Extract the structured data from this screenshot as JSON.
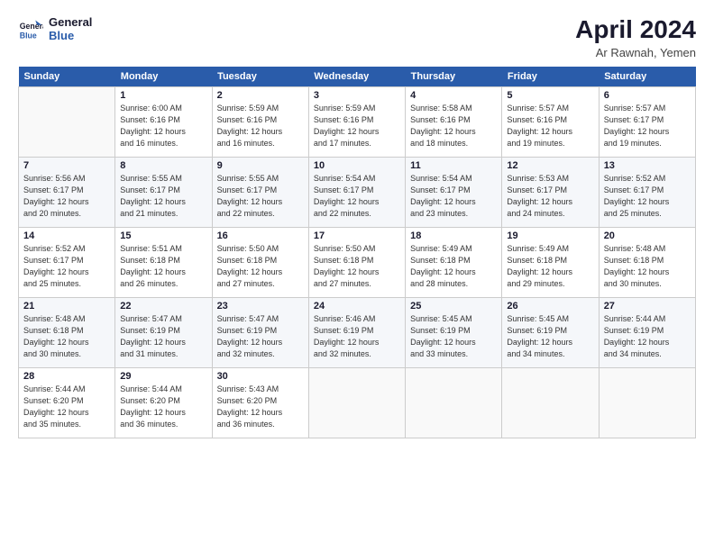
{
  "logo": {
    "line1": "General",
    "line2": "Blue"
  },
  "title": "April 2024",
  "location": "Ar Rawnah, Yemen",
  "days_of_week": [
    "Sunday",
    "Monday",
    "Tuesday",
    "Wednesday",
    "Thursday",
    "Friday",
    "Saturday"
  ],
  "weeks": [
    [
      {
        "day": null
      },
      {
        "day": "1",
        "sunrise": "6:00 AM",
        "sunset": "6:16 PM",
        "daylight": "12 hours and 16 minutes."
      },
      {
        "day": "2",
        "sunrise": "5:59 AM",
        "sunset": "6:16 PM",
        "daylight": "12 hours and 16 minutes."
      },
      {
        "day": "3",
        "sunrise": "5:59 AM",
        "sunset": "6:16 PM",
        "daylight": "12 hours and 17 minutes."
      },
      {
        "day": "4",
        "sunrise": "5:58 AM",
        "sunset": "6:16 PM",
        "daylight": "12 hours and 18 minutes."
      },
      {
        "day": "5",
        "sunrise": "5:57 AM",
        "sunset": "6:16 PM",
        "daylight": "12 hours and 19 minutes."
      },
      {
        "day": "6",
        "sunrise": "5:57 AM",
        "sunset": "6:17 PM",
        "daylight": "12 hours and 19 minutes."
      }
    ],
    [
      {
        "day": "7",
        "sunrise": "5:56 AM",
        "sunset": "6:17 PM",
        "daylight": "12 hours and 20 minutes."
      },
      {
        "day": "8",
        "sunrise": "5:55 AM",
        "sunset": "6:17 PM",
        "daylight": "12 hours and 21 minutes."
      },
      {
        "day": "9",
        "sunrise": "5:55 AM",
        "sunset": "6:17 PM",
        "daylight": "12 hours and 22 minutes."
      },
      {
        "day": "10",
        "sunrise": "5:54 AM",
        "sunset": "6:17 PM",
        "daylight": "12 hours and 22 minutes."
      },
      {
        "day": "11",
        "sunrise": "5:54 AM",
        "sunset": "6:17 PM",
        "daylight": "12 hours and 23 minutes."
      },
      {
        "day": "12",
        "sunrise": "5:53 AM",
        "sunset": "6:17 PM",
        "daylight": "12 hours and 24 minutes."
      },
      {
        "day": "13",
        "sunrise": "5:52 AM",
        "sunset": "6:17 PM",
        "daylight": "12 hours and 25 minutes."
      }
    ],
    [
      {
        "day": "14",
        "sunrise": "5:52 AM",
        "sunset": "6:17 PM",
        "daylight": "12 hours and 25 minutes."
      },
      {
        "day": "15",
        "sunrise": "5:51 AM",
        "sunset": "6:18 PM",
        "daylight": "12 hours and 26 minutes."
      },
      {
        "day": "16",
        "sunrise": "5:50 AM",
        "sunset": "6:18 PM",
        "daylight": "12 hours and 27 minutes."
      },
      {
        "day": "17",
        "sunrise": "5:50 AM",
        "sunset": "6:18 PM",
        "daylight": "12 hours and 27 minutes."
      },
      {
        "day": "18",
        "sunrise": "5:49 AM",
        "sunset": "6:18 PM",
        "daylight": "12 hours and 28 minutes."
      },
      {
        "day": "19",
        "sunrise": "5:49 AM",
        "sunset": "6:18 PM",
        "daylight": "12 hours and 29 minutes."
      },
      {
        "day": "20",
        "sunrise": "5:48 AM",
        "sunset": "6:18 PM",
        "daylight": "12 hours and 30 minutes."
      }
    ],
    [
      {
        "day": "21",
        "sunrise": "5:48 AM",
        "sunset": "6:18 PM",
        "daylight": "12 hours and 30 minutes."
      },
      {
        "day": "22",
        "sunrise": "5:47 AM",
        "sunset": "6:19 PM",
        "daylight": "12 hours and 31 minutes."
      },
      {
        "day": "23",
        "sunrise": "5:47 AM",
        "sunset": "6:19 PM",
        "daylight": "12 hours and 32 minutes."
      },
      {
        "day": "24",
        "sunrise": "5:46 AM",
        "sunset": "6:19 PM",
        "daylight": "12 hours and 32 minutes."
      },
      {
        "day": "25",
        "sunrise": "5:45 AM",
        "sunset": "6:19 PM",
        "daylight": "12 hours and 33 minutes."
      },
      {
        "day": "26",
        "sunrise": "5:45 AM",
        "sunset": "6:19 PM",
        "daylight": "12 hours and 34 minutes."
      },
      {
        "day": "27",
        "sunrise": "5:44 AM",
        "sunset": "6:19 PM",
        "daylight": "12 hours and 34 minutes."
      }
    ],
    [
      {
        "day": "28",
        "sunrise": "5:44 AM",
        "sunset": "6:20 PM",
        "daylight": "12 hours and 35 minutes."
      },
      {
        "day": "29",
        "sunrise": "5:44 AM",
        "sunset": "6:20 PM",
        "daylight": "12 hours and 36 minutes."
      },
      {
        "day": "30",
        "sunrise": "5:43 AM",
        "sunset": "6:20 PM",
        "daylight": "12 hours and 36 minutes."
      },
      {
        "day": null
      },
      {
        "day": null
      },
      {
        "day": null
      },
      {
        "day": null
      }
    ]
  ]
}
